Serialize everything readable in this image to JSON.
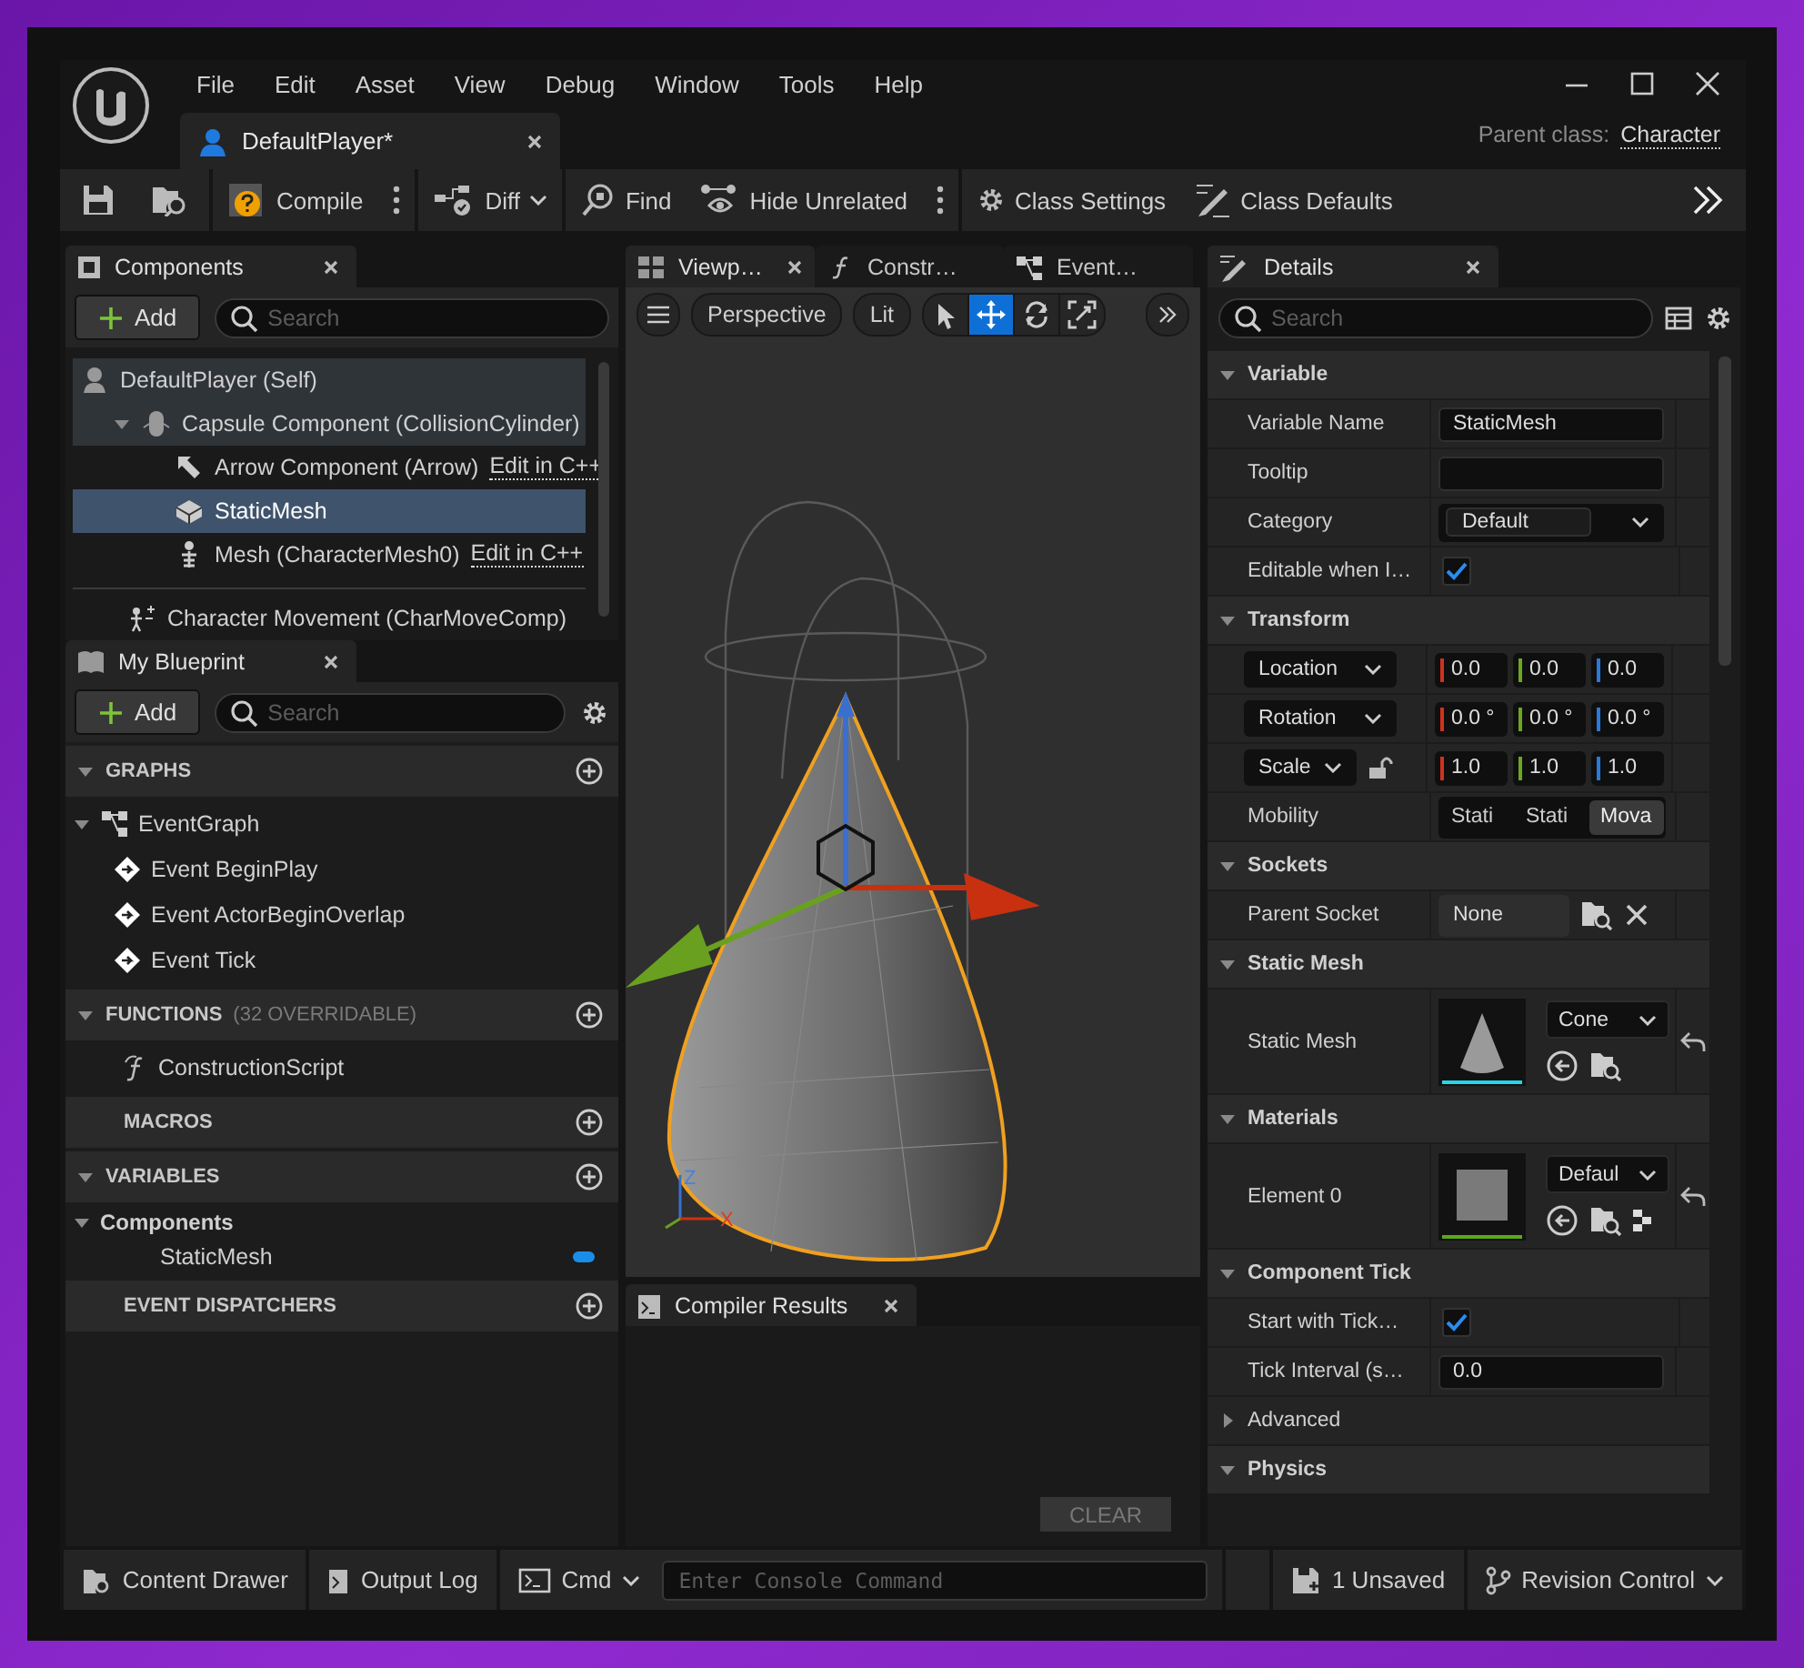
{
  "window": {
    "menu": [
      "File",
      "Edit",
      "Asset",
      "View",
      "Debug",
      "Window",
      "Tools",
      "Help"
    ],
    "document_tab": {
      "title": "DefaultPlayer*",
      "selected": true
    },
    "parent_class": {
      "label": "Parent class:",
      "value": "Character"
    }
  },
  "toolbar": {
    "compile": "Compile",
    "diff": "Diff",
    "find": "Find",
    "hide_unrelated": "Hide Unrelated",
    "class_settings": "Class Settings",
    "class_defaults": "Class Defaults"
  },
  "components_panel": {
    "tab": "Components",
    "add_button": "Add",
    "search": {
      "placeholder": "Search"
    },
    "tree": [
      {
        "kind": "actor",
        "label": "DefaultPlayer (Self)",
        "selected": false,
        "children": [
          {
            "kind": "capsule",
            "label": "Capsule Component (CollisionCylinder)",
            "selected": false,
            "expanded": true,
            "children": [
              {
                "kind": "arrow",
                "label": "Arrow Component (Arrow)",
                "link": "Edit in C++",
                "selected": false
              },
              {
                "kind": "static_mesh",
                "label": "StaticMesh",
                "selected": true
              },
              {
                "kind": "skeletal_mesh",
                "label": "Mesh (CharacterMesh0)",
                "link": "Edit in C++",
                "selected": false
              }
            ]
          }
        ]
      }
    ],
    "other_components": [
      {
        "kind": "movement",
        "label": "Character Movement (CharMoveComp)",
        "selected": false
      }
    ]
  },
  "my_blueprint": {
    "tab": "My Blueprint",
    "add_button": "Add",
    "search": {
      "placeholder": "Search"
    },
    "sections": [
      {
        "title": "GRAPHS",
        "expanded": true,
        "items": [
          {
            "kind": "graph",
            "label": "EventGraph",
            "expanded": true,
            "children": [
              {
                "kind": "event",
                "label": "Event BeginPlay"
              },
              {
                "kind": "event",
                "label": "Event ActorBeginOverlap"
              },
              {
                "kind": "event",
                "label": "Event Tick"
              }
            ]
          }
        ]
      },
      {
        "title": "FUNCTIONS",
        "note": "(32 OVERRIDABLE)",
        "expanded": true,
        "items": [
          {
            "kind": "function",
            "label": "ConstructionScript"
          }
        ]
      },
      {
        "title": "MACROS"
      },
      {
        "title": "VARIABLES",
        "expanded": true,
        "items": [
          {
            "kind": "category",
            "label": "Components",
            "expanded": true,
            "children": [
              {
                "kind": "variable",
                "label": "StaticMesh"
              }
            ]
          }
        ]
      },
      {
        "title": "EVENT DISPATCHERS"
      }
    ]
  },
  "editor_tabs": [
    {
      "kind": "viewport",
      "label": "Viewp…",
      "selected": true
    },
    {
      "kind": "function",
      "label": "Constr…",
      "selected": false
    },
    {
      "kind": "graph",
      "label": "Event…",
      "selected": false
    }
  ],
  "viewport": {
    "view_mode": "Perspective",
    "lighting": "Lit",
    "tools": [
      {
        "kind": "select",
        "selected": false
      },
      {
        "kind": "move",
        "selected": true
      },
      {
        "kind": "rotate",
        "selected": false
      },
      {
        "kind": "scale",
        "selected": false
      }
    ],
    "axis_labels": {
      "z": "Z",
      "x": "X"
    }
  },
  "compiler_results": {
    "tab": "Compiler Results",
    "clear_button": "CLEAR",
    "clear_disabled": true
  },
  "details": {
    "tab": "Details",
    "search": {
      "placeholder": "Search"
    },
    "sections": [
      {
        "kind": "category",
        "title": "Variable",
        "expanded": true,
        "rows": [
          {
            "kind": "text",
            "label": "Variable Name",
            "value": "StaticMesh"
          },
          {
            "kind": "text",
            "label": "Tooltip"
          },
          {
            "kind": "combo",
            "label": "Category",
            "value": "Default"
          },
          {
            "kind": "checkbox",
            "label": "Editable when I…",
            "checked": true
          }
        ]
      },
      {
        "kind": "category",
        "title": "Transform",
        "expanded": true,
        "rows": [
          {
            "kind": "vector",
            "label": "Location",
            "values": [
              "0.0",
              "0.0",
              "0.0"
            ]
          },
          {
            "kind": "vector",
            "label": "Rotation",
            "values": [
              "0.0 °",
              "0.0 °",
              "0.0 °"
            ]
          },
          {
            "kind": "vector",
            "label": "Scale",
            "locked": false,
            "values": [
              "1.0",
              "1.0",
              "1.0"
            ]
          },
          {
            "kind": "segmented",
            "label": "Mobility",
            "options": [
              {
                "label": "Stati",
                "selected": false
              },
              {
                "label": "Stati",
                "selected": false
              },
              {
                "label": "Mova",
                "selected": true
              }
            ]
          }
        ]
      },
      {
        "kind": "category",
        "title": "Sockets",
        "expanded": true,
        "rows": [
          {
            "kind": "socket",
            "label": "Parent Socket",
            "value": "None"
          }
        ]
      },
      {
        "kind": "category",
        "title": "Static Mesh",
        "expanded": true,
        "rows": [
          {
            "kind": "mesh_asset",
            "label": "Static Mesh",
            "value": "Cone"
          }
        ]
      },
      {
        "kind": "category",
        "title": "Materials",
        "expanded": true,
        "rows": [
          {
            "kind": "material_asset",
            "label": "Element 0",
            "value": "Defaul"
          }
        ]
      },
      {
        "kind": "category",
        "title": "Component Tick",
        "expanded": true,
        "rows": [
          {
            "kind": "checkbox",
            "label": "Start with Tick…",
            "checked": true
          },
          {
            "kind": "text",
            "label": "Tick Interval (s…",
            "value": "0.0"
          }
        ]
      },
      {
        "kind": "group",
        "title": "Advanced",
        "expanded": false
      },
      {
        "kind": "category",
        "title": "Physics",
        "expanded": true
      }
    ]
  },
  "status_bar": {
    "content_drawer": "Content Drawer",
    "output_log": "Output Log",
    "cmd": "Cmd",
    "console": {
      "placeholder": "Enter Console Command"
    },
    "unsaved": "1 Unsaved",
    "revision_control": "Revision Control"
  }
}
